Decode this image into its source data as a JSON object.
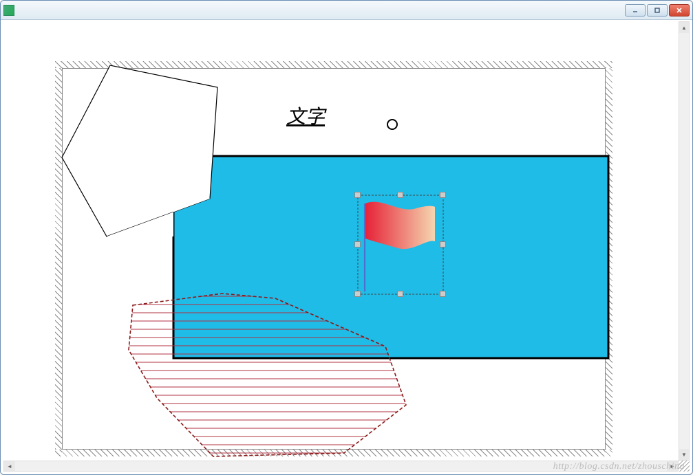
{
  "window": {
    "title": " "
  },
  "canvas": {
    "text_label": "文字",
    "shapes": {
      "blue_rect_fill": "#20bce8",
      "flag_gradient_from": "#e62238",
      "flag_gradient_to": "#f5d6b0",
      "hatch_color": "#b03040",
      "selection_border": "#5070d0"
    }
  },
  "watermark": "http://blog.csdn.net/zhouschina"
}
